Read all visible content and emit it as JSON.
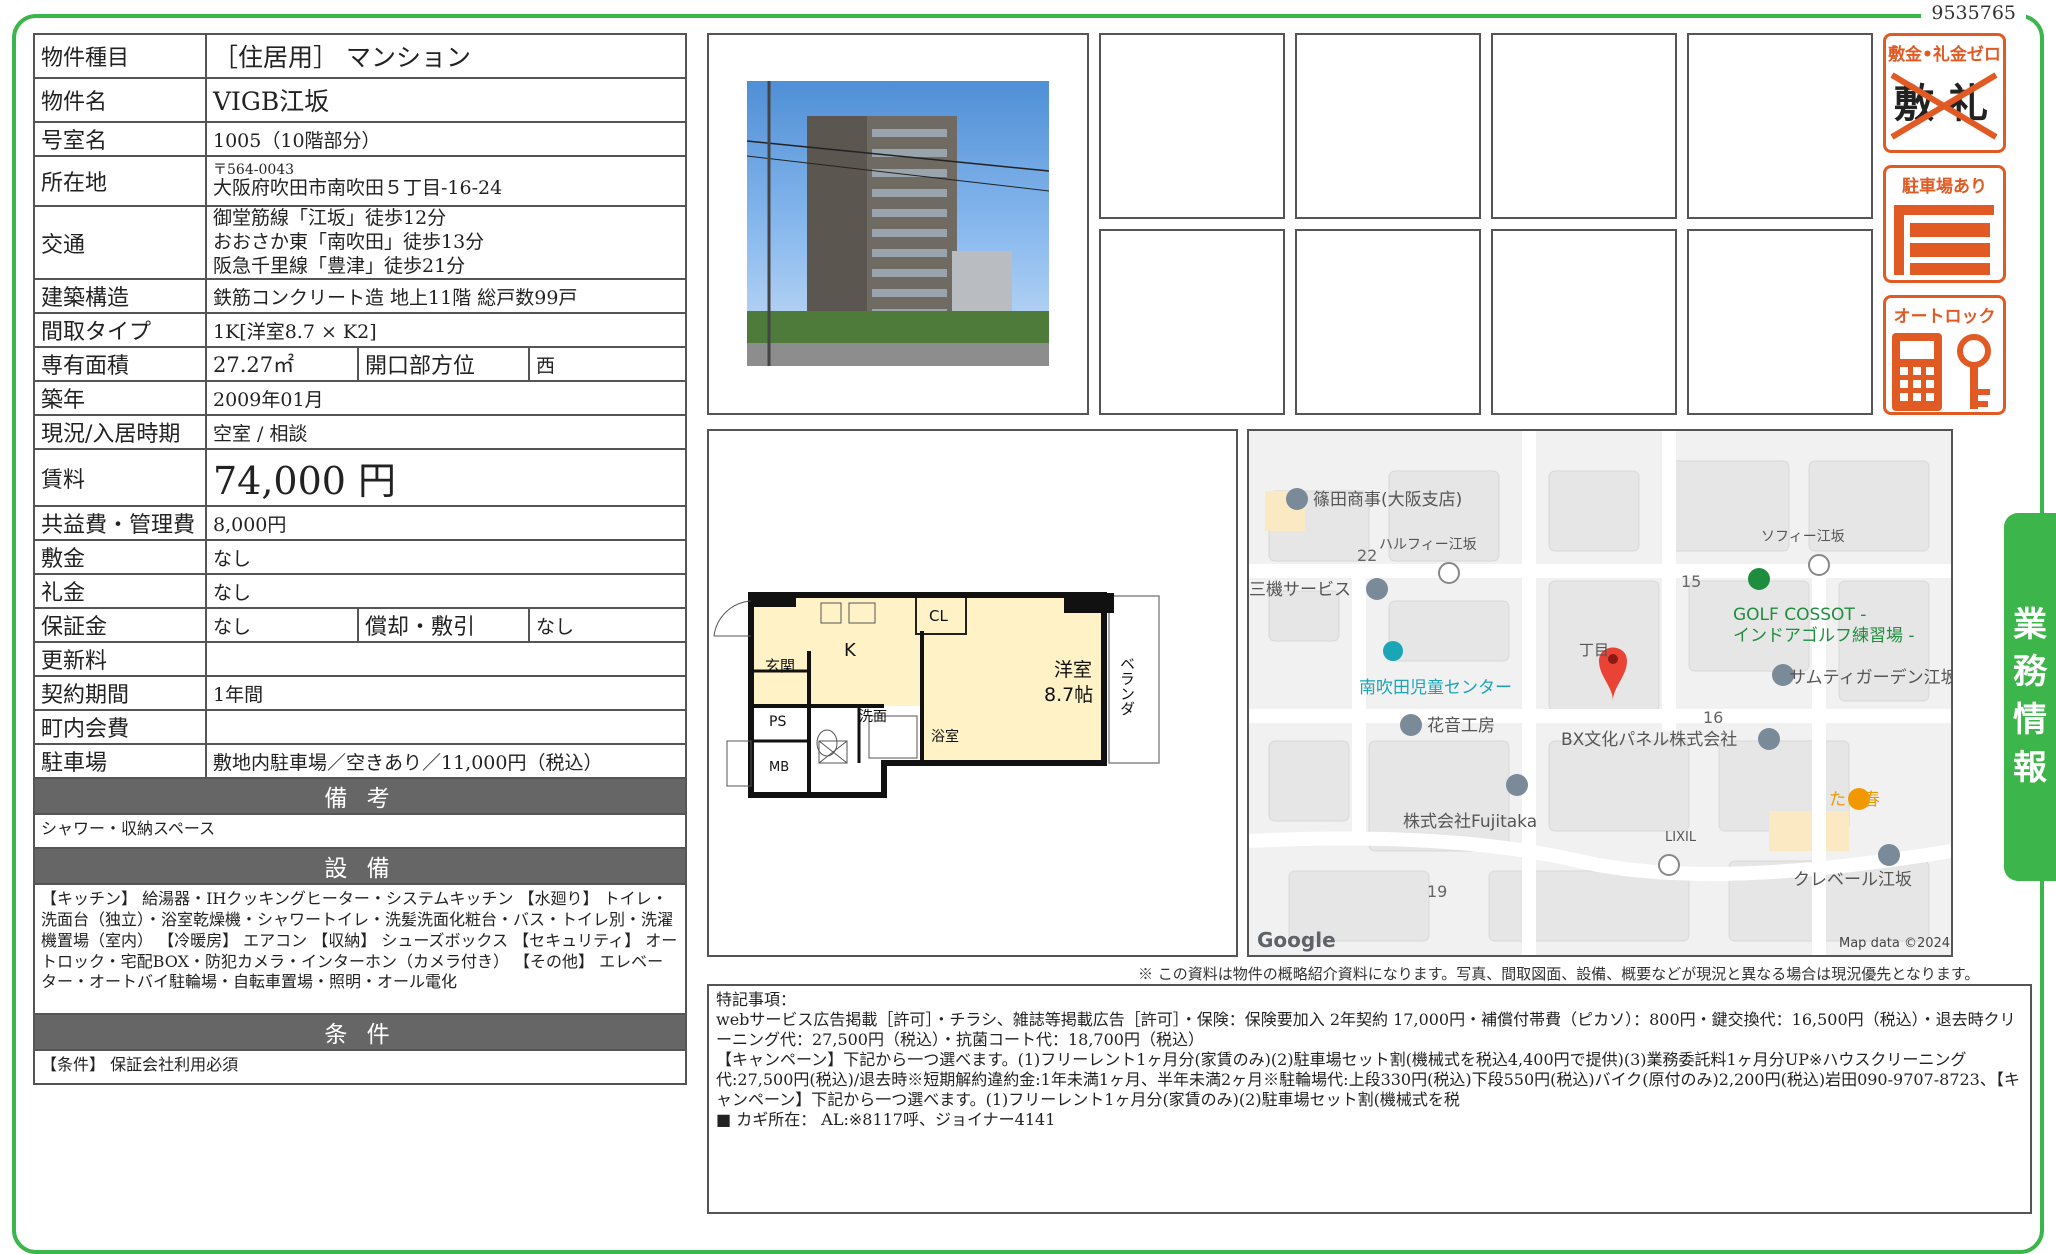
{
  "doc_id": "9535765",
  "side_tab": {
    "chars": [
      "業",
      "務",
      "情",
      "報"
    ]
  },
  "property": {
    "type_label": "物件種目",
    "type": "［住居用］ マンション",
    "name_label": "物件名",
    "name": "VIGB江坂",
    "room_label": "号室名",
    "room": "1005（10階部分）",
    "address_label": "所在地",
    "postal": "〒564-0043",
    "address": "大阪府吹田市南吹田５丁目-16-24",
    "access_label": "交通",
    "access": [
      "御堂筋線「江坂」徒歩12分",
      "おおさか東「南吹田」徒歩13分",
      "阪急千里線「豊津」徒歩21分"
    ],
    "structure_label": "建築構造",
    "structure": "鉄筋コンクリート造 地上11階 総戸数99戸",
    "layout_label": "間取タイプ",
    "layout": "1K[洋室8.7 × K2]",
    "area_label": "専有面積",
    "area": "27.27㎡",
    "orientation_label": "開口部方位",
    "orientation": "西",
    "built_label": "築年",
    "built": "2009年01月",
    "status_label": "現況/入居時期",
    "status": "空室 / 相談",
    "rent_label": "賃料",
    "rent": "74,000 円",
    "mgmt_label": "共益費・管理費",
    "mgmt": "8,000円",
    "deposit_label": "敷金",
    "deposit": "なし",
    "keymoney_label": "礼金",
    "keymoney": "なし",
    "guarantee_label": "保証金",
    "guarantee": "なし",
    "amort_label": "償却・敷引",
    "amort": "なし",
    "renewal_label": "更新料",
    "renewal": "",
    "contract_label": "契約期間",
    "contract": "1年間",
    "community_label": "町内会費",
    "community": "",
    "parking_label": "駐車場",
    "parking": "敷地内駐車場／空きあり／11,000円（税込）",
    "remarks_header": "備 考",
    "remarks": "シャワー・収納スペース",
    "equipment_header": "設 備",
    "equipment": "【キッチン】 給湯器・IHクッキングヒーター・システムキッチン 【水廻り】 トイレ・洗面台（独立）・浴室乾燥機・シャワートイレ・洗髪洗面化粧台・バス・トイレ別・洗濯機置場（室内） 【冷暖房】 エアコン 【収納】 シューズボックス 【セキュリティ】 オートロック・宅配BOX・防犯カメラ・インターホン（カメラ付き） 【その他】 エレベーター・オートバイ駐輪場・自転車置場・照明・オール電化",
    "conditions_header": "条 件",
    "conditions": "【条件】 保証会社利用必須"
  },
  "badges": [
    {
      "title": "敷金•礼金ゼロ",
      "icon": "no-deposit-icon"
    },
    {
      "title": "駐車場あり",
      "icon": "parking-icon"
    },
    {
      "title": "オートロック",
      "icon": "autolock-icon"
    }
  ],
  "floorplan": {
    "labels": {
      "genkan": "玄関",
      "kitchen": "K",
      "cl": "CL",
      "room": "洋室",
      "room_size": "8.7帖",
      "veranda": "ベランダ",
      "ps": "PS",
      "mb": "MB",
      "washroom": "洗面",
      "bath": "浴室"
    }
  },
  "map": {
    "places": [
      "篠田商事(大阪支店)",
      "ハルフィー江坂",
      "ソフィー江坂",
      "三機サービス",
      "GOLF COSSOT -",
      "インドアゴルフ練習場 -",
      "南吹田児童センター",
      "サムティガーデン江坂I",
      "花音工房",
      "BX文化パネル株式会社",
      "株式会社Fujitaka",
      "たこ春",
      "LIXIL",
      "クレベール江坂",
      "丁目"
    ],
    "numbers": [
      "22",
      "15",
      "16",
      "19"
    ],
    "logo": "Google",
    "attribution": "Map data ©2024"
  },
  "disclaimer": "※ この資料は物件の概略紹介資料になります。写真、間取図面、設備、概要などが現況と異なる場合は現況優先となります。",
  "special_notes": "特記事項：\nwebサービス広告掲載［許可］・チラシ、雑誌等掲載広告［許可］・保険：保険要加入 2年契約 17,000円・補償付帯費（ピカソ）：800円・鍵交換代：16,500円（税込）・退去時クリーニング代：27,500円（税込）・抗菌コート代：18,700円（税込）\n【キャンペーン】下記から一つ選べます。(1)フリーレント1ヶ月分(家賃のみ)(2)駐車場セット割(機械式を税込4,400円で提供)(3)業務委託料1ヶ月分UP※ハウスクリーニング代:27,500円(税込)/退去時※短期解約違約金:1年未満1ヶ月、半年未満2ヶ月※駐輪場代:上段330円(税込)下段550円(税込)バイク(原付のみ)2,200円(税込)岩田090-9707-8723、【キャンペーン】下記から一つ選べます。(1)フリーレント1ヶ月分(家賃のみ)(2)駐車場セット割(機械式を税\n■ カギ所在： AL:※8117呼、ジョイナー4141"
}
